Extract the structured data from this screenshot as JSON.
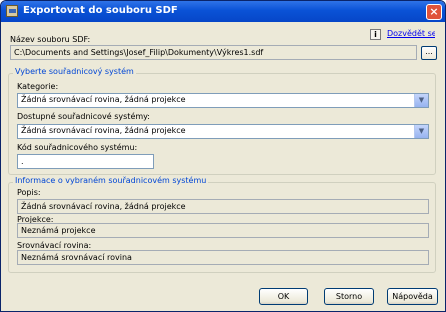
{
  "window": {
    "title": "Exportovat do souboru SDF",
    "close_label": "×"
  },
  "file": {
    "label": "Název souboru SDF:",
    "path": "C:\\Documents and Settings\\Josef_Filip\\Dokumenty\\Výkres1.sdf",
    "browse_label": "...",
    "info_icon": "i",
    "help_link": "Dozvědět se více"
  },
  "coord_group": {
    "legend": "Vyberte souřadnicový systém",
    "category_label": "Kategorie:",
    "category_value": "Žádná srovnávací rovina, žádná projekce",
    "available_label": "Dostupné souřadnicové systémy:",
    "available_value": "Žádná srovnávací rovina, žádná projekce",
    "code_label": "Kód souřadnicového systému:",
    "code_value": "."
  },
  "info_group": {
    "legend": "Informace o vybraném souřadnicovém systému",
    "description_label": "Popis:",
    "description_value": "Žádná srovnávací rovina, žádná projekce",
    "projection_label": "Projekce:",
    "projection_value": "Neznámá projekce",
    "datum_label": "Srovnávací rovina:",
    "datum_value": "Neznámá srovnávací rovina"
  },
  "buttons": {
    "ok": "OK",
    "cancel": "Storno",
    "help": "Nápověda"
  },
  "icons": {
    "app": "dialog-icon",
    "info": "info-icon",
    "dropdown": "chevron-down-icon"
  }
}
